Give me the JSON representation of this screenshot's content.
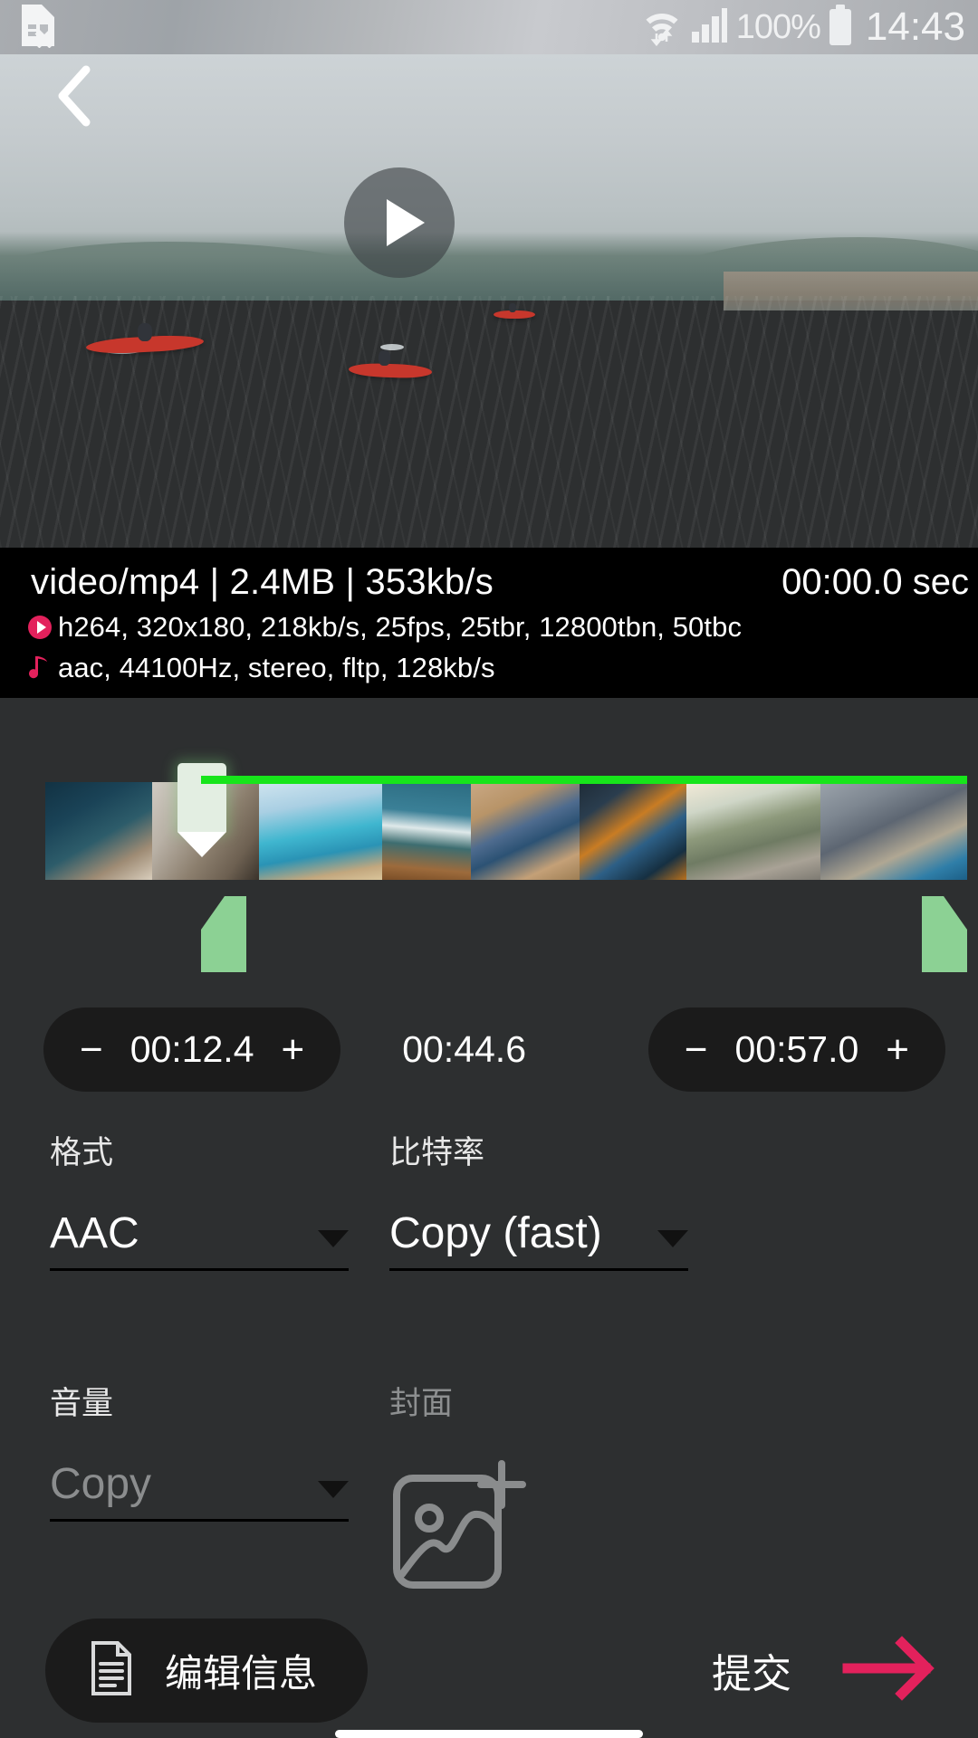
{
  "status_bar": {
    "sim_icon": "sim-card-error-icon",
    "wifi_icon": "wifi-icon",
    "signal_icon": "cellular-signal-icon",
    "battery_percent": "100%",
    "battery_icon": "battery-full-icon",
    "clock": "14:43"
  },
  "player": {
    "back_icon": "back-chevron-icon",
    "play_icon": "play-icon"
  },
  "info": {
    "summary": "video/mp4 | 2.4MB | 353kb/s",
    "duration": "00:00.0 sec",
    "video_icon": "video-stream-icon",
    "video_stream": "h264, 320x180, 218kb/s, 25fps, 25tbr, 12800tbn, 50tbc",
    "audio_icon": "audio-note-icon",
    "audio_stream": "aac, 44100Hz, stereo, fltp, 128kb/s"
  },
  "timeline": {
    "playhead_icon": "playhead-marker-icon",
    "left_handle_icon": "trim-start-handle-icon",
    "right_handle_icon": "trim-end-handle-icon",
    "selection_color": "#17e51b",
    "handle_color": "#8cd194"
  },
  "trim": {
    "minus": "−",
    "plus": "+",
    "start_time": "00:12.4",
    "selected_duration": "00:44.6",
    "end_time": "00:57.0"
  },
  "fields": {
    "format": {
      "label": "格式",
      "value": "AAC",
      "caret_icon": "chevron-down-icon"
    },
    "bitrate": {
      "label": "比特率",
      "value": "Copy (fast)",
      "caret_icon": "chevron-down-icon"
    },
    "volume": {
      "label": "音量",
      "value": "Copy",
      "caret_icon": "chevron-down-icon"
    },
    "cover": {
      "label": "封面",
      "icon": "add-image-icon"
    }
  },
  "bottom": {
    "edit_info_icon": "document-edit-icon",
    "edit_info_label": "编辑信息",
    "submit_label": "提交",
    "submit_icon": "arrow-right-icon",
    "accent_color": "#e3215c"
  }
}
